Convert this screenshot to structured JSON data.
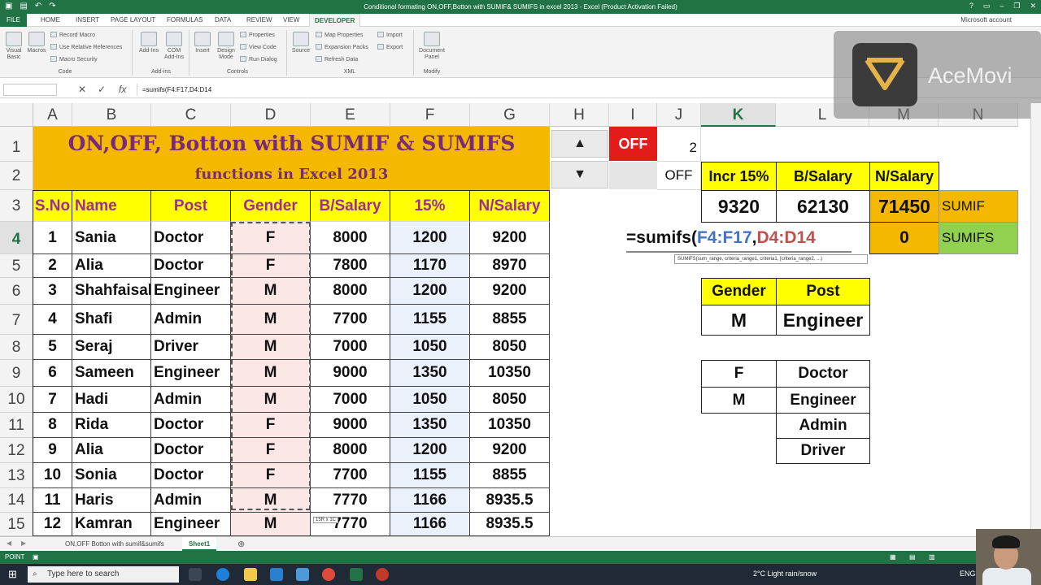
{
  "window": {
    "title": "Conditional formating ON,OFF,Botton with SUMIF& SUMIFS  in excel 2013 -  Excel (Product Activation Failed)",
    "account": "Microsoft account"
  },
  "ribbon_tabs": [
    "FILE",
    "HOME",
    "INSERT",
    "PAGE LAYOUT",
    "FORMULAS",
    "DATA",
    "REVIEW",
    "VIEW",
    "DEVELOPER"
  ],
  "ribbon": {
    "code": {
      "visual_basic": "Visual Basic",
      "macros": "Macros",
      "record": "Record Macro",
      "relative": "Use Relative References",
      "security": "Macro Security",
      "group": "Code"
    },
    "addins": {
      "addins": "Add-Ins",
      "com": "COM Add-Ins",
      "group": "Add-ins"
    },
    "controls": {
      "insert": "Insert",
      "design": "Design Mode",
      "properties": "Properties",
      "view_code": "View Code",
      "run_dialog": "Run Dialog",
      "group": "Controls"
    },
    "xml": {
      "source": "Source",
      "map_props": "Map Properties",
      "expansion": "Expansion Packs",
      "refresh": "Refresh Data",
      "import": "Import",
      "export": "Export",
      "group": "XML"
    },
    "modify": {
      "doc_panel": "Document Panel",
      "group": "Modify"
    }
  },
  "formula_bar": {
    "fx": "fx",
    "content": "=sumifs(F4:F17,D4:D14"
  },
  "columns": [
    "A",
    "B",
    "C",
    "D",
    "E",
    "F",
    "G",
    "H",
    "I",
    "J",
    "K",
    "L",
    "M",
    "N"
  ],
  "rows": [
    "1",
    "2",
    "3",
    "4",
    "5",
    "6",
    "7",
    "8",
    "9",
    "10",
    "11",
    "12",
    "13",
    "14",
    "15"
  ],
  "banner": {
    "line1": "ON,OFF, Botton with SUMIF  & SUMIFS",
    "line2": "functions in Excel 2013"
  },
  "table": {
    "headers": [
      "S.No",
      "Name",
      "Post",
      "Gender",
      "B/Salary",
      "15%",
      "N/Salary"
    ],
    "rows": [
      [
        "1",
        "Sania",
        "Doctor",
        "F",
        "8000",
        "1200",
        "9200"
      ],
      [
        "2",
        "Alia",
        "Doctor",
        "F",
        "7800",
        "1170",
        "8970"
      ],
      [
        "3",
        "Shahfaisal",
        "Engineer",
        "M",
        "8000",
        "1200",
        "9200"
      ],
      [
        "4",
        "Shafi",
        "Admin",
        "M",
        "7700",
        "1155",
        "8855"
      ],
      [
        "5",
        "Seraj",
        "Driver",
        "M",
        "7000",
        "1050",
        "8050"
      ],
      [
        "6",
        "Sameen",
        "Engineer",
        "M",
        "9000",
        "1350",
        "10350"
      ],
      [
        "7",
        "Hadi",
        "Admin",
        "M",
        "7000",
        "1050",
        "8050"
      ],
      [
        "8",
        "Rida",
        "Doctor",
        "F",
        "9000",
        "1350",
        "10350"
      ],
      [
        "9",
        "Alia",
        "Doctor",
        "F",
        "8000",
        "1200",
        "9200"
      ],
      [
        "10",
        "Sonia",
        "Doctor",
        "F",
        "7700",
        "1155",
        "8855"
      ],
      [
        "11",
        "Haris",
        "Admin",
        "M",
        "7770",
        "1166",
        "8935.5"
      ],
      [
        "12",
        "Kamran",
        "Engineer",
        "M",
        "7770",
        "1166",
        "8935.5"
      ]
    ]
  },
  "controls": {
    "up": "▲",
    "down": "▼",
    "off_red": "OFF",
    "j1": "2",
    "off_label": "OFF"
  },
  "summary": {
    "headers": [
      "Incr 15%",
      "B/Salary",
      "N/Salary"
    ],
    "values": [
      "9320",
      "62130",
      "71450"
    ],
    "sumif_label": "SUMIF",
    "sumifs_value": "0",
    "sumifs_label": "SUMIFS",
    "edit_prefix": "=sumifs(",
    "edit_ref1": "F4:F17",
    "edit_comma": ",",
    "edit_ref2": "D4:D14",
    "tooltip": "SUMIFS(sum_range, criteria_range1, criteria1, [criteria_range2, ...)"
  },
  "criteria": {
    "headers": [
      "Gender",
      "Post"
    ],
    "gender": "M",
    "post": "Engineer",
    "gender_list": [
      "F",
      "M"
    ],
    "post_list": [
      "Doctor",
      "Engineer",
      "Admin",
      "Driver"
    ]
  },
  "marquee_tip": "15R x 1C",
  "sheets": [
    "ON,OFF Botton with sumif&sumifs",
    "Sheet1"
  ],
  "status": {
    "mode": "POINT"
  },
  "taskbar": {
    "search": "Type here to search",
    "weather": "2°C  Light rain/snow",
    "lang": "ENG"
  },
  "watermark": {
    "text": "AceMovi"
  },
  "colors": {
    "excel_green": "#217346",
    "banner": "#f5b800",
    "header_yellow": "#ffff00",
    "purple_text": "#a02aa0",
    "off_red": "#e31b1b",
    "sumifs_green": "#92d050"
  }
}
